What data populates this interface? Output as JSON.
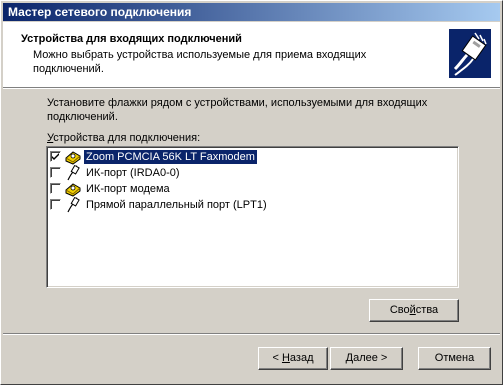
{
  "window": {
    "title": "Мастер сетевого подключения"
  },
  "header": {
    "title": "Устройства для входящих подключений",
    "subtitle": "Можно выбрать устройства используемые для приема входящих подключений.",
    "icon": "network-cable-icon"
  },
  "instruction": "Установите флажки рядом с устройствами, используемыми для входящих подключений.",
  "devices": {
    "label_accel": "У",
    "label_rest": "стройства для подключения:",
    "items": [
      {
        "label": "Zoom PCMCIA 56K LT Faxmodem",
        "checked": true,
        "selected": true,
        "icon": "modem-icon"
      },
      {
        "label": "ИК-порт (IRDA0-0)",
        "checked": false,
        "selected": false,
        "icon": "port-cable-icon"
      },
      {
        "label": "ИК-порт модема",
        "checked": false,
        "selected": false,
        "icon": "modem-icon"
      },
      {
        "label": "Прямой параллельный порт (LPT1)",
        "checked": false,
        "selected": false,
        "icon": "port-cable-icon"
      }
    ]
  },
  "buttons": {
    "properties_before": "Сво",
    "properties_accel": "й",
    "properties_after": "ства",
    "back_prefix": "< ",
    "back_accel": "Н",
    "back_rest": "азад",
    "next": "Далее >",
    "cancel": "Отмена"
  },
  "colors": {
    "titlebar_start": "#0a246a",
    "titlebar_end": "#a6caf0",
    "selection": "#0a246a",
    "face": "#d4d0c8"
  }
}
